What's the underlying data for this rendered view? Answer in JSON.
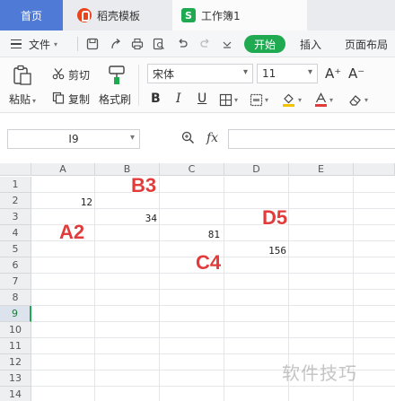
{
  "tabs": {
    "home": "首页",
    "templates": "稻壳模板",
    "workbook": "工作簿1",
    "sheet_logo_letter": "S"
  },
  "menu": {
    "file": "文件",
    "start": "开始",
    "insert": "插入",
    "page_layout": "页面布局"
  },
  "ribbon": {
    "cut": "剪切",
    "copy": "复制",
    "paste": "粘贴",
    "format_painter": "格式刷",
    "font_name": "宋体",
    "font_size": "11",
    "bold": "B",
    "italic": "I",
    "underline": "U",
    "grow_font": "A⁺",
    "shrink_font": "A⁻"
  },
  "formula_bar": {
    "name_box": "I9",
    "fx": "fx",
    "formula": ""
  },
  "grid": {
    "columns": [
      "A",
      "B",
      "C",
      "D",
      "E"
    ],
    "rows": [
      "1",
      "2",
      "3",
      "4",
      "5",
      "6",
      "7",
      "8",
      "9",
      "10",
      "11",
      "12",
      "13",
      "14"
    ],
    "active_row": "9",
    "cells": {
      "A2": "12",
      "B3": "34",
      "C4": "81",
      "D5": "156"
    }
  },
  "annotations": {
    "a2": "A2",
    "b3": "B3",
    "c4": "C4",
    "d5": "D5"
  },
  "watermark": "软件技巧",
  "colors": {
    "accent_green": "#1faa52",
    "home_tab_blue": "#4f7bd6",
    "annotation_red": "#e23b3b"
  }
}
